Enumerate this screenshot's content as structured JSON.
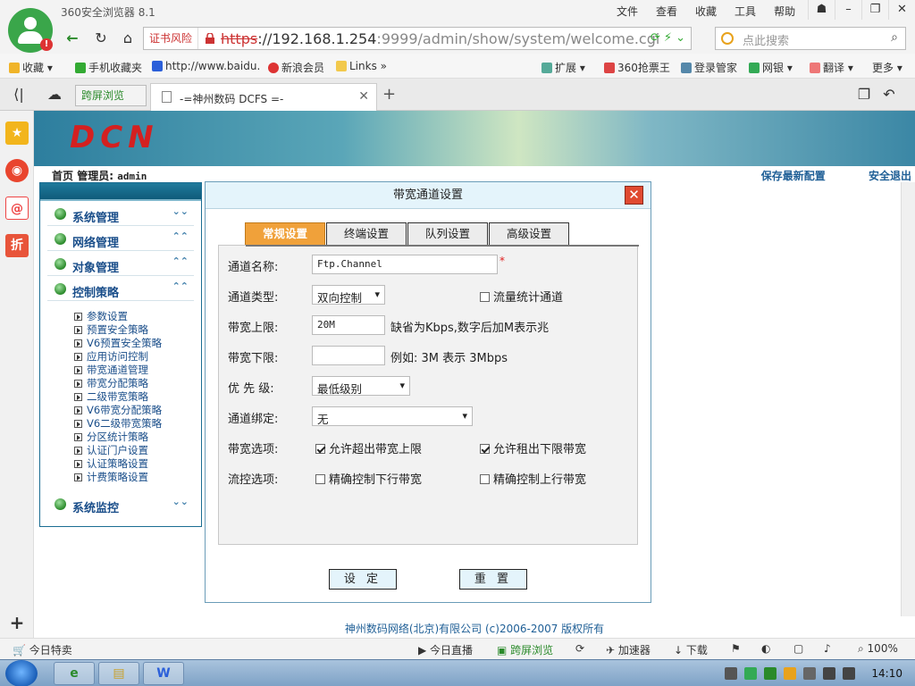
{
  "browser": {
    "app_title": "360安全浏览器 8.1",
    "menu": [
      "文件",
      "查看",
      "收藏",
      "工具",
      "帮助"
    ],
    "cert_warning": "证书风险",
    "url_proto": "https",
    "url_host": "://192.168.1.254",
    "url_rest": ":9999/admin/show/system/welcome.cgi",
    "search_placeholder": "点此搜索",
    "favorites": [
      "收藏",
      "手机收藏夹",
      "http://www.baidu.",
      "新浪会员",
      "Links"
    ],
    "toolbar_right": [
      "扩展",
      "360抢票王",
      "登录管家",
      "网银",
      "翻译",
      "更多"
    ],
    "tab_split_label": "跨屏浏览",
    "tab_title": "-=神州数码 DCFS =-",
    "status": {
      "left": "今日特卖",
      "live": "今日直播",
      "split": "跨屏浏览",
      "accelerator": "加速器",
      "download": "下载",
      "zoom": "100%"
    }
  },
  "page": {
    "logo": "DCN",
    "breadcrumb_home": "首页",
    "breadcrumb_admin_label": "管理员:",
    "breadcrumb_admin_user": "admin",
    "save_config": "保存最新配置",
    "logout": "安全退出",
    "copyright": "神州数码网络(北京)有限公司  (c)2006-2007  版权所有"
  },
  "left_menu": {
    "sections": [
      {
        "label": "系统管理",
        "chevron": "⌄⌄"
      },
      {
        "label": "网络管理",
        "chevron": "⌃⌃"
      },
      {
        "label": "对象管理",
        "chevron": "⌃⌃"
      },
      {
        "label": "控制策略",
        "chevron": "⌃⌃"
      }
    ],
    "sub_items": [
      "参数设置",
      "预置安全策略",
      "V6预置安全策略",
      "应用访问控制",
      "带宽通道管理",
      "带宽分配策略",
      "二级带宽策略",
      "V6带宽分配策略",
      "V6二级带宽策略",
      "分区统计策略",
      "认证门户设置",
      "认证策略设置",
      "计费策略设置"
    ],
    "bottom_section": {
      "label": "系统监控",
      "chevron": "⌄⌄"
    }
  },
  "dialog": {
    "title": "带宽通道设置",
    "tabs": [
      "常规设置",
      "终端设置",
      "队列设置",
      "高级设置"
    ],
    "active_tab": 0,
    "fields": {
      "name_label": "通道名称:",
      "name_value": "Ftp.Channel",
      "required_mark": "*",
      "type_label": "通道类型:",
      "type_value": "双向控制",
      "traffic_stat_label": "流量统计通道",
      "upper_label": "带宽上限:",
      "upper_value": "20M",
      "upper_hint": "缺省为Kbps,数字后加M表示兆",
      "lower_label": "带宽下限:",
      "lower_value": "",
      "lower_hint": "例如: 3M 表示 3Mbps",
      "priority_label": "优 先 级:",
      "priority_value": "最低级别",
      "bind_label": "通道绑定:",
      "bind_value": "无",
      "bw_option_label": "带宽选项:",
      "allow_exceed_upper": "允许超出带宽上限",
      "allow_borrow_lower": "允许租出下限带宽",
      "flow_option_label": "流控选项:",
      "precise_down": "精确控制下行带宽",
      "precise_up": "精确控制上行带宽"
    },
    "checks": {
      "traffic_stat": false,
      "allow_exceed_upper": true,
      "allow_borrow_lower": true,
      "precise_down": false,
      "precise_up": false
    },
    "buttons": {
      "set": "设 定",
      "reset": "重 置"
    }
  },
  "taskbar": {
    "clock": "14:10"
  },
  "colors": {
    "active_tab": "#f0a13a",
    "menu_text": "#1a4e8a",
    "dialog_title_bg": "#e4f4fb",
    "close_btn": "#e04a30"
  }
}
